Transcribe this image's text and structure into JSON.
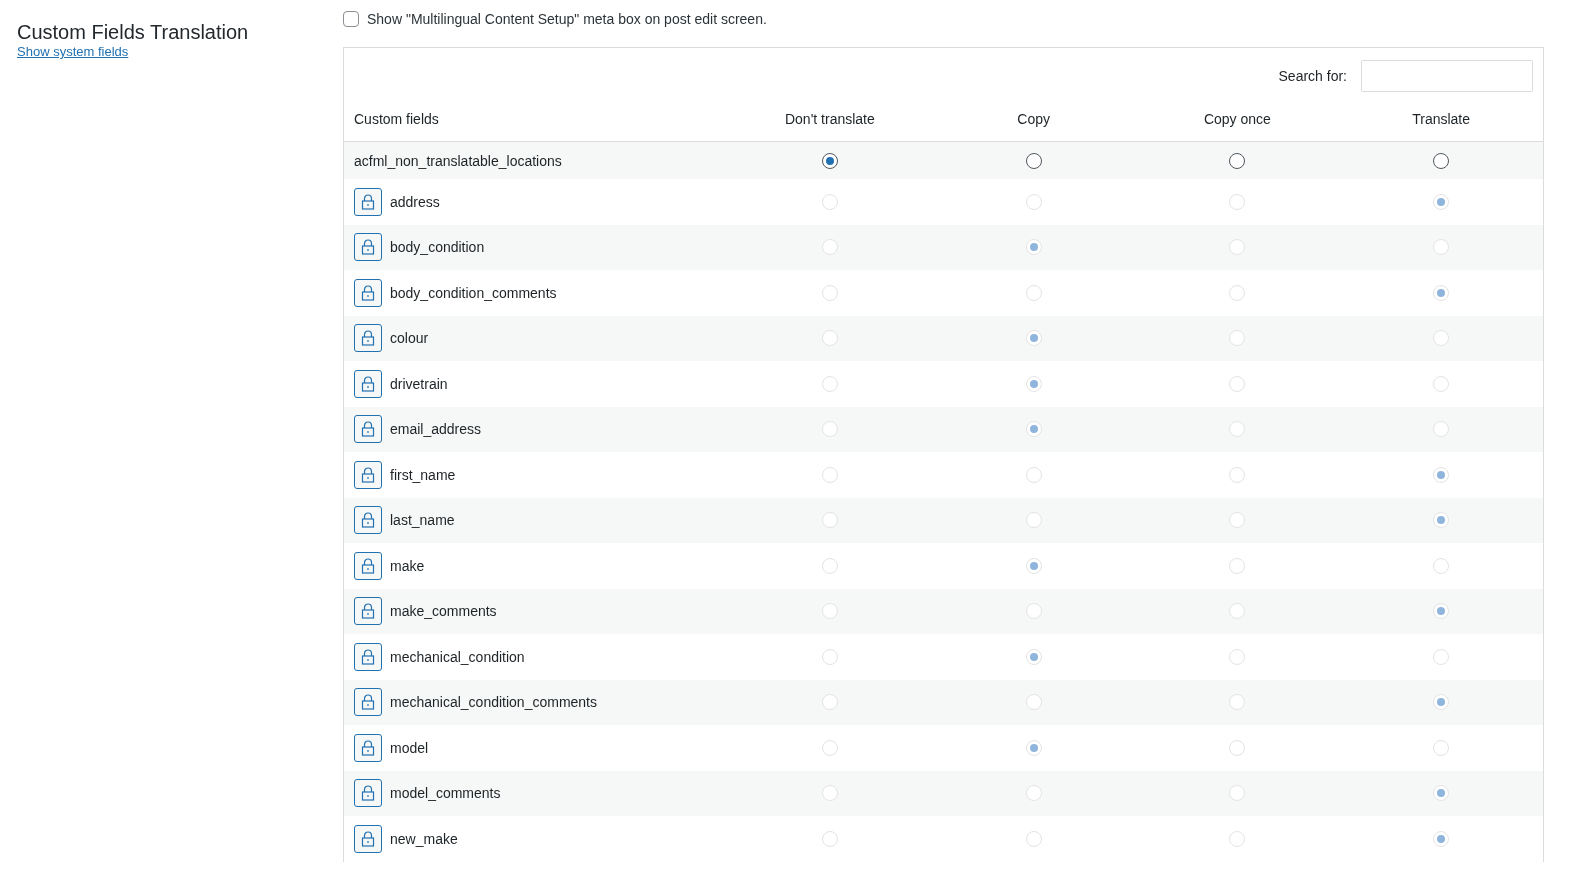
{
  "title": "Custom Fields Translation",
  "show_system_fields_link": "Show system fields",
  "meta_box_option": {
    "label": "Show \"Multilingual Content Setup\" meta box on post edit screen.",
    "checked": false
  },
  "search": {
    "label": "Search for:"
  },
  "table": {
    "columns": [
      "Custom fields",
      "Don't translate",
      "Copy",
      "Copy once",
      "Translate"
    ],
    "rows": [
      {
        "name": "acfml_non_translatable_locations",
        "locked": false,
        "options": [
          {
            "selected": true
          },
          {
            "selected": false
          },
          {
            "selected": false
          },
          {
            "selected": false
          }
        ]
      },
      {
        "name": "address",
        "locked": true,
        "options": [
          {
            "selected": false
          },
          {
            "selected": false
          },
          {
            "selected": false
          },
          {
            "selected": true
          }
        ]
      },
      {
        "name": "body_condition",
        "locked": true,
        "options": [
          {
            "selected": false
          },
          {
            "selected": true
          },
          {
            "selected": false
          },
          {
            "selected": false
          }
        ]
      },
      {
        "name": "body_condition_comments",
        "locked": true,
        "options": [
          {
            "selected": false
          },
          {
            "selected": false
          },
          {
            "selected": false
          },
          {
            "selected": true
          }
        ]
      },
      {
        "name": "colour",
        "locked": true,
        "options": [
          {
            "selected": false
          },
          {
            "selected": true
          },
          {
            "selected": false
          },
          {
            "selected": false
          }
        ]
      },
      {
        "name": "drivetrain",
        "locked": true,
        "options": [
          {
            "selected": false
          },
          {
            "selected": true
          },
          {
            "selected": false
          },
          {
            "selected": false
          }
        ]
      },
      {
        "name": "email_address",
        "locked": true,
        "options": [
          {
            "selected": false
          },
          {
            "selected": true
          },
          {
            "selected": false
          },
          {
            "selected": false
          }
        ]
      },
      {
        "name": "first_name",
        "locked": true,
        "options": [
          {
            "selected": false
          },
          {
            "selected": false
          },
          {
            "selected": false
          },
          {
            "selected": true
          }
        ]
      },
      {
        "name": "last_name",
        "locked": true,
        "options": [
          {
            "selected": false
          },
          {
            "selected": false
          },
          {
            "selected": false
          },
          {
            "selected": true
          }
        ]
      },
      {
        "name": "make",
        "locked": true,
        "options": [
          {
            "selected": false
          },
          {
            "selected": true
          },
          {
            "selected": false
          },
          {
            "selected": false
          }
        ]
      },
      {
        "name": "make_comments",
        "locked": true,
        "options": [
          {
            "selected": false
          },
          {
            "selected": false
          },
          {
            "selected": false
          },
          {
            "selected": true
          }
        ]
      },
      {
        "name": "mechanical_condition",
        "locked": true,
        "options": [
          {
            "selected": false
          },
          {
            "selected": true
          },
          {
            "selected": false
          },
          {
            "selected": false
          }
        ]
      },
      {
        "name": "mechanical_condition_comments",
        "locked": true,
        "options": [
          {
            "selected": false
          },
          {
            "selected": false
          },
          {
            "selected": false
          },
          {
            "selected": true
          }
        ]
      },
      {
        "name": "model",
        "locked": true,
        "options": [
          {
            "selected": false
          },
          {
            "selected": true
          },
          {
            "selected": false
          },
          {
            "selected": false
          }
        ]
      },
      {
        "name": "model_comments",
        "locked": true,
        "options": [
          {
            "selected": false
          },
          {
            "selected": false
          },
          {
            "selected": false
          },
          {
            "selected": true
          }
        ]
      },
      {
        "name": "new_make",
        "locked": true,
        "options": [
          {
            "selected": false
          },
          {
            "selected": false
          },
          {
            "selected": false
          },
          {
            "selected": true
          }
        ]
      }
    ]
  }
}
